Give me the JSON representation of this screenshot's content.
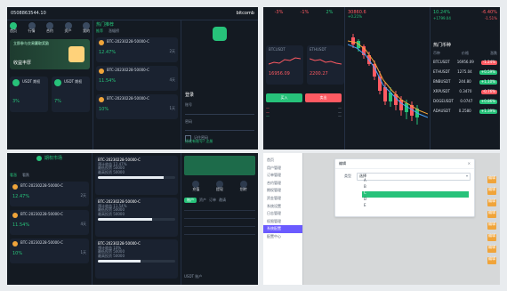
{
  "colors": {
    "bg": "#e9ecef",
    "dark": "#141a22",
    "panel2": "#1a2230",
    "green": "#27c27a",
    "red": "#ff5a62",
    "orange": "#f0a43a",
    "white": "#ffffff"
  },
  "top_left": {
    "header_number": "0508863544.10",
    "brand_name": "bitcomb",
    "nav_labels": [
      "首页",
      "行情",
      "合约",
      "资产",
      "我的"
    ],
    "section_title": "热门推荐",
    "section_tabs": [
      "推荐",
      "涨幅榜"
    ],
    "pairs": [
      {
        "name": "BTC-20230228-50000-C",
        "value": "12.47%",
        "right": "2天"
      },
      {
        "name": "BTC-20230228-50000-C",
        "value": "11.54%",
        "right": "4天"
      },
      {
        "name": "BTC-20230228-50000-C",
        "value": "10%",
        "right": "1天"
      }
    ],
    "promo_text": "立即参与交易赢取奖励",
    "promo_title": "收益丰厚",
    "bottom_cards": [
      {
        "label": "USDT 期权",
        "value": "3%"
      },
      {
        "label": "USDT 期权",
        "value": "7%"
      }
    ],
    "form_title": "登录",
    "form_fields": [
      "账号",
      "密码"
    ],
    "form_checkbox": "记住密码",
    "form_submit": "登录",
    "form_footer": "还没有账号? 注册"
  },
  "top_right": {
    "header_values": [
      "-3%",
      "-1%",
      "2%"
    ],
    "headline_price": "30860.6",
    "headline_sub": "+0.21%",
    "left_metrics": [
      {
        "label": "BTCUSDT",
        "value": "16956.09"
      },
      {
        "label": "ETHUSDT",
        "value": "2200.27"
      }
    ],
    "order_tabs": [
      "买入",
      "卖出"
    ],
    "market_title": "热门币种",
    "market_header": [
      "币种",
      "价格",
      "涨跌"
    ],
    "market_rows": [
      {
        "name": "BTCUSDT",
        "price": "16956.09",
        "chg": "-1.24%",
        "state": "down"
      },
      {
        "name": "ETHUSDT",
        "price": "1275.04",
        "chg": "+0.59%",
        "state": "up"
      },
      {
        "name": "BNBUSDT",
        "price": "244.80",
        "chg": "+1.10%",
        "state": "up"
      },
      {
        "name": "XRPUSDT",
        "price": "0.3470",
        "chg": "-0.76%",
        "state": "down"
      },
      {
        "name": "DOGEUSDT",
        "price": "0.0747",
        "chg": "+0.86%",
        "state": "up"
      },
      {
        "name": "ADAUSDT",
        "price": "0.2580",
        "chg": "+1.39%",
        "state": "up"
      }
    ],
    "top_right_numbers": [
      "10.24%",
      "-6.40%",
      "+1.72%"
    ],
    "top_right_labels": [
      "+1799.04",
      "-1.51%",
      "+2.12%"
    ]
  },
  "bottom_left": {
    "section_title": "期权市场",
    "tabs": [
      "看涨",
      "看跌"
    ],
    "items": [
      {
        "name": "BTC-20230228-50000-C",
        "value": "12.47%",
        "right": "2天"
      },
      {
        "name": "BTC-20230228-50000-C",
        "value": "11.54%",
        "right": "4天"
      },
      {
        "name": "BTC-20230228-50000-C",
        "value": "10%",
        "right": "1天"
      }
    ],
    "detail_cards": [
      {
        "title": "BTC-20230228-50000-C",
        "lines": [
          "预计收益 12.47%",
          "最低投资 50000",
          "最高投资 50000"
        ],
        "progress": 0.85
      },
      {
        "title": "BTC-20230228-50000-C",
        "lines": [
          "预计收益 11.54%",
          "最低投资 50000",
          "最高投资 50000"
        ],
        "progress": 0.7
      },
      {
        "title": "BTC-20230228-50000-C",
        "lines": [
          "预计收益 10%",
          "最低投资 50000",
          "最高投资 50000"
        ],
        "progress": 0.55
      }
    ],
    "right_tabs": [
      "充值",
      "提现",
      "划转"
    ],
    "right_sections": [
      "账户",
      "资产",
      "订单",
      "邀请"
    ],
    "right_footer": "USDT 账户"
  },
  "bottom_right": {
    "sidebar_items": [
      "首页",
      "用户管理",
      "订单管理",
      "合约管理",
      "期权管理",
      "资金管理",
      "系统设置",
      "日志管理",
      "权限管理",
      "配置中心"
    ],
    "active_item": "系统配置",
    "dialog_title": "编辑",
    "dialog_label": "类型",
    "dialog_options": [
      "选择",
      "A",
      "B",
      "C",
      "D",
      "E"
    ],
    "dialog_selected": "选择",
    "dialog_highlight": "C",
    "list_tags": [
      "编辑",
      "编辑",
      "编辑",
      "编辑",
      "编辑",
      "编辑",
      "编辑",
      "编辑",
      "编辑",
      "编辑"
    ]
  }
}
